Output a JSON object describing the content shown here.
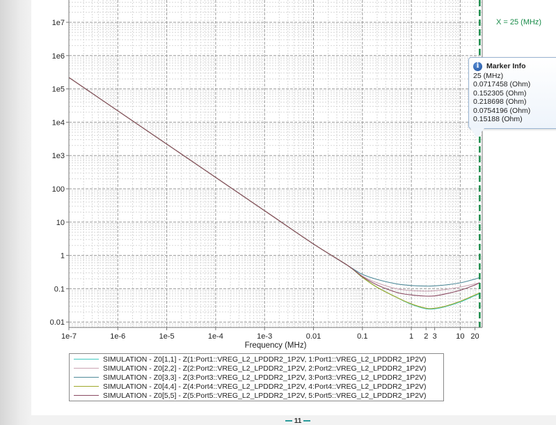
{
  "chart_data": {
    "type": "line",
    "xscale": "log",
    "yscale": "log",
    "xlabel": "Frequency (MHz)",
    "ylabel": "",
    "xlim": [
      1e-07,
      30
    ],
    "ylim": [
      0.008,
      30000000.0
    ],
    "x_ticks": [
      {
        "value": 1e-07,
        "label": "1e-7"
      },
      {
        "value": 1e-06,
        "label": "1e-6"
      },
      {
        "value": 1e-05,
        "label": "1e-5"
      },
      {
        "value": 0.0001,
        "label": "1e-4"
      },
      {
        "value": 0.001,
        "label": "1e-3"
      },
      {
        "value": 0.01,
        "label": "0.01"
      },
      {
        "value": 0.1,
        "label": "0.1"
      },
      {
        "value": 1,
        "label": "1"
      },
      {
        "value": 2,
        "label": "2"
      },
      {
        "value": 3,
        "label": "3"
      },
      {
        "value": 10,
        "label": "10"
      },
      {
        "value": 20,
        "label": "20"
      }
    ],
    "y_ticks": [
      {
        "value": 10000000.0,
        "label": "1e7"
      },
      {
        "value": 1000000.0,
        "label": "1e6"
      },
      {
        "value": 100000.0,
        "label": "1e5"
      },
      {
        "value": 10000.0,
        "label": "1e4"
      },
      {
        "value": 1000.0,
        "label": "1e3"
      },
      {
        "value": 100,
        "label": "100"
      },
      {
        "value": 10,
        "label": "10"
      },
      {
        "value": 1,
        "label": "1"
      },
      {
        "value": 0.1,
        "label": "0.1"
      },
      {
        "value": 0.01,
        "label": "0.01"
      }
    ],
    "grid": true,
    "legend_position": "bottom",
    "marker": {
      "x": 25,
      "label": "X = 25 (MHz)",
      "color": "#1a8c4a"
    },
    "series": [
      {
        "name": "SIMULATION - Z0[1,1] - Z(1:Port1::VREG_L2_LPDDR2_1P2V, 1:Port1::VREG_L2_LPDDR2_1P2V)",
        "color": "#3fc9c0",
        "x": [
          1e-07,
          1e-05,
          0.001,
          0.01,
          0.05,
          0.1,
          0.2,
          0.5,
          1,
          2,
          3,
          5,
          10,
          20,
          25
        ],
        "y": [
          220000.0,
          2200,
          22,
          2.2,
          0.5,
          0.22,
          0.11,
          0.055,
          0.034,
          0.025,
          0.025,
          0.029,
          0.04,
          0.062,
          0.0717458
        ]
      },
      {
        "name": "SIMULATION - Z0[2,2] - Z(2:Port2::VREG_L2_LPDDR2_1P2V, 2:Port2::VREG_L2_LPDDR2_1P2V)",
        "color": "#c9a3b2",
        "x": [
          1e-07,
          1e-05,
          0.001,
          0.01,
          0.05,
          0.1,
          0.2,
          0.5,
          1,
          2,
          3,
          5,
          10,
          20,
          25
        ],
        "y": [
          220000.0,
          2200,
          22,
          2.2,
          0.5,
          0.24,
          0.15,
          0.1,
          0.088,
          0.085,
          0.087,
          0.095,
          0.112,
          0.14,
          0.152305
        ]
      },
      {
        "name": "SIMULATION - Z0[3,3] - Z(3:Port3::VREG_L2_LPDDR2_1P2V, 3:Port3::VREG_L2_LPDDR2_1P2V)",
        "color": "#4f8a99",
        "x": [
          1e-07,
          1e-05,
          0.001,
          0.01,
          0.05,
          0.1,
          0.2,
          0.5,
          1,
          2,
          3,
          5,
          10,
          20,
          25
        ],
        "y": [
          220000.0,
          2200,
          22,
          2.2,
          0.5,
          0.27,
          0.19,
          0.14,
          0.125,
          0.12,
          0.122,
          0.13,
          0.15,
          0.195,
          0.218698
        ]
      },
      {
        "name": "SIMULATION - Z0[4,4] - Z(4:Port4::VREG_L2_LPDDR2_1P2V, 4:Port4::VREG_L2_LPDDR2_1P2V)",
        "color": "#9fa82a",
        "x": [
          1e-07,
          1e-05,
          0.001,
          0.01,
          0.05,
          0.1,
          0.2,
          0.5,
          1,
          2,
          3,
          5,
          10,
          20,
          25
        ],
        "y": [
          220000.0,
          2200,
          22,
          2.2,
          0.5,
          0.22,
          0.11,
          0.055,
          0.035,
          0.026,
          0.026,
          0.03,
          0.042,
          0.065,
          0.0754196
        ]
      },
      {
        "name": "SIMULATION - Z0[5,5] - Z(5:Port5::VREG_L2_LPDDR2_1P2V, 5:Port5::VREG_L2_LPDDR2_1P2V)",
        "color": "#8a4a62",
        "x": [
          1e-07,
          1e-05,
          0.001,
          0.01,
          0.05,
          0.1,
          0.2,
          0.5,
          1,
          2,
          3,
          5,
          10,
          20,
          25
        ],
        "y": [
          220000.0,
          2200,
          22,
          2.2,
          0.5,
          0.23,
          0.13,
          0.078,
          0.065,
          0.06,
          0.061,
          0.07,
          0.09,
          0.13,
          0.15188
        ]
      }
    ]
  },
  "marker_info": {
    "title": "Marker Info",
    "icon": "info-icon",
    "lines": [
      "25 (MHz)",
      "0.0717458 (Ohm)",
      "0.152305 (Ohm)",
      "0.218698 (Ohm)",
      "0.0754196 (Ohm)",
      "0.15188 (Ohm)"
    ]
  },
  "page_number": "11"
}
